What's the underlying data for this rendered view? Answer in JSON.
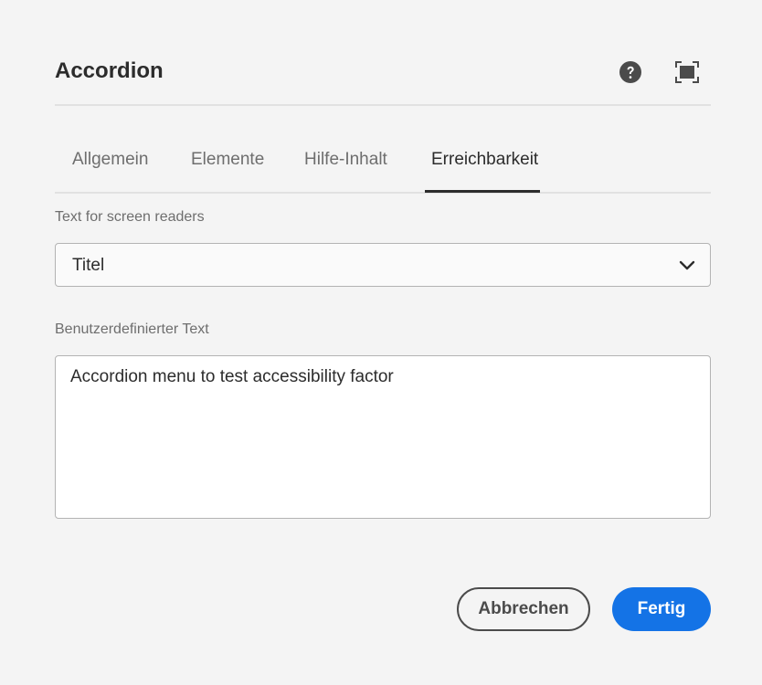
{
  "dialog": {
    "title": "Accordion",
    "help_icon": "help-circle-icon",
    "fullscreen_icon": "fullscreen-icon"
  },
  "tabs": [
    {
      "label": "Allgemein",
      "active": false
    },
    {
      "label": "Elemente",
      "active": false
    },
    {
      "label": "Hilfe-Inhalt",
      "active": false
    },
    {
      "label": "Erreichbarkeit",
      "active": true
    }
  ],
  "accessibility": {
    "screen_reader_label": "Text for screen readers",
    "screen_reader_value": "Titel",
    "custom_text_label": "Benutzerdefinierter Text",
    "custom_text_value": "Accordion menu to test accessibility factor"
  },
  "footer": {
    "cancel_label": "Abbrechen",
    "done_label": "Fertig"
  },
  "colors": {
    "accent": "#1473e6",
    "background": "#f4f4f4",
    "text": "#2c2c2c"
  }
}
